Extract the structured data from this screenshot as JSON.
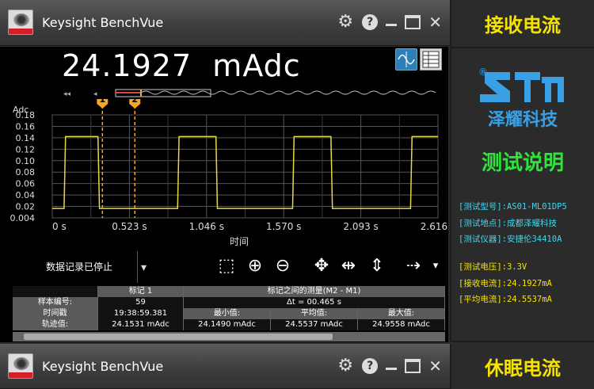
{
  "app": {
    "name": "Keysight BenchVue"
  },
  "measurement": {
    "reading": "24.1927  mAdc"
  },
  "chart_data": {
    "type": "line",
    "ylabel": "Adc",
    "xlabel": "时间",
    "x_ticks": [
      "0 s",
      "0.523 s",
      "1.046 s",
      "1.570 s",
      "2.093 s",
      "2.616 s"
    ],
    "y_ticks": [
      "0.18",
      "0.16",
      "0.14",
      "0.12",
      "0.10",
      "0.08",
      "0.06",
      "0.04",
      "0.02",
      "0.004"
    ],
    "ylim": [
      0.004,
      0.18
    ],
    "xlim": [
      0,
      2.616
    ],
    "grid": true,
    "series": [
      {
        "x": [
          0,
          0.08,
          0.09,
          0.31,
          0.32,
          0.85,
          0.86,
          1.11,
          1.12,
          1.63,
          1.64,
          1.89,
          1.9,
          2.43,
          2.44,
          2.616
        ],
        "values": [
          0.02,
          0.02,
          0.143,
          0.143,
          0.02,
          0.02,
          0.143,
          0.143,
          0.02,
          0.02,
          0.143,
          0.143,
          0.02,
          0.02,
          0.143,
          0.143
        ]
      }
    ],
    "markers": [
      {
        "label": "1",
        "x": 0.34
      },
      {
        "label": "2",
        "x": 0.56
      }
    ],
    "color": "#e6d84a"
  },
  "controls": {
    "status": "数据记录已停止"
  },
  "markers_table": {
    "marker1_header": "标记 1",
    "between_header": "标记之间的测量(M2 - M1)",
    "sample_label": "样本编号:",
    "sample_value": "59",
    "delta_t": "Δt = 00.465 s",
    "timestamp_label": "时间戳",
    "timestamp_value": "19:38:59.381",
    "min_label": "最小值:",
    "avg_label": "平均值:",
    "max_label": "最大值:",
    "trace_label": "轨迹值:",
    "trace_value": "24.1531 mAdc",
    "min_value": "24.1490 mAdc",
    "avg_value": "24.5537 mAdc",
    "max_value": "24.9558 mAdc"
  },
  "panel": {
    "title_top": "接收电流",
    "title_bottom": "休眠电流",
    "brand_name": "泽耀科技",
    "registered": "®",
    "desc_title": "测试说明",
    "model": "[测试型号]:AS01-ML01DP5",
    "location": "[测试地点]:成都泽耀科技",
    "instrument": "[测试仪器]:安捷伦34410A",
    "voltage": "[测试电压]:3.3V",
    "rx_current": "[接收电流]:24.1927mA",
    "avg_current": "[平均电流]:24.5537mA"
  },
  "colors": {
    "trace": "#e6d84a",
    "marker": "#f5a623",
    "panel_yellow": "#f5e400",
    "brand_blue": "#39a0e6",
    "info_cyan": "#3fd7f0",
    "title_green": "#2ee43b"
  }
}
